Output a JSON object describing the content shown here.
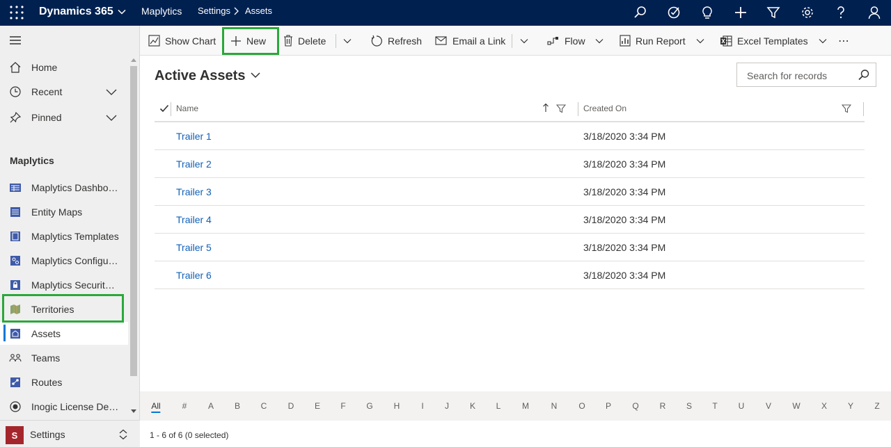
{
  "topbar": {
    "app_name": "Dynamics 365",
    "area": "Maplytics",
    "breadcrumb": [
      "Settings",
      "Assets"
    ],
    "icons": [
      "search-icon",
      "task-icon",
      "lightbulb-icon",
      "plus-icon",
      "filter-icon",
      "gear-icon",
      "help-icon",
      "user-icon"
    ]
  },
  "sidebar": {
    "top_items": [
      {
        "label": "Home",
        "icon": "home-icon"
      },
      {
        "label": "Recent",
        "icon": "clock-icon"
      },
      {
        "label": "Pinned",
        "icon": "pin-icon"
      }
    ],
    "group_title": "Maplytics",
    "items": [
      {
        "label": "Maplytics Dashboard",
        "icon": "dashboard-icon"
      },
      {
        "label": "Entity Maps",
        "icon": "entity-map-icon"
      },
      {
        "label": "Maplytics Templates",
        "icon": "template-icon"
      },
      {
        "label": "Maplytics Configuration",
        "icon": "configuration-icon"
      },
      {
        "label": "Maplytics Security Templates",
        "icon": "lock-icon"
      },
      {
        "label": "Territories",
        "icon": "territory-icon"
      },
      {
        "label": "Assets",
        "icon": "asset-icon"
      },
      {
        "label": "Teams",
        "icon": "team-icon"
      },
      {
        "label": "Routes",
        "icon": "route-icon"
      },
      {
        "label": "Inogic License Details",
        "icon": "license-icon"
      }
    ],
    "selected": "Assets",
    "area_switcher": {
      "initial": "S",
      "label": "Settings"
    }
  },
  "commandbar": {
    "show_chart": "Show Chart",
    "new": "New",
    "delete": "Delete",
    "refresh": "Refresh",
    "email_link": "Email a Link",
    "flow": "Flow",
    "run_report": "Run Report",
    "excel_templates": "Excel Templates",
    "more": "⋯"
  },
  "view": {
    "title": "Active Assets",
    "search_placeholder": "Search for records"
  },
  "grid": {
    "columns": [
      "Name",
      "Created On"
    ],
    "rows": [
      {
        "name": "Trailer 1",
        "created_on": "3/18/2020 3:34 PM"
      },
      {
        "name": "Trailer 2",
        "created_on": "3/18/2020 3:34 PM"
      },
      {
        "name": "Trailer 3",
        "created_on": "3/18/2020 3:34 PM"
      },
      {
        "name": "Trailer 4",
        "created_on": "3/18/2020 3:34 PM"
      },
      {
        "name": "Trailer 5",
        "created_on": "3/18/2020 3:34 PM"
      },
      {
        "name": "Trailer 6",
        "created_on": "3/18/2020 3:34 PM"
      }
    ]
  },
  "jumpbar": {
    "letters": [
      "All",
      "#",
      "A",
      "B",
      "C",
      "D",
      "E",
      "F",
      "G",
      "H",
      "I",
      "J",
      "K",
      "L",
      "M",
      "N",
      "O",
      "P",
      "Q",
      "R",
      "S",
      "T",
      "U",
      "V",
      "W",
      "X",
      "Y",
      "Z"
    ],
    "active": "All"
  },
  "footer": {
    "status": "1 - 6 of 6 (0 selected)"
  },
  "colors": {
    "topbar": "#002050",
    "link": "#1160b7",
    "highlight": "#2aa83a",
    "accent": "#0078d4"
  }
}
